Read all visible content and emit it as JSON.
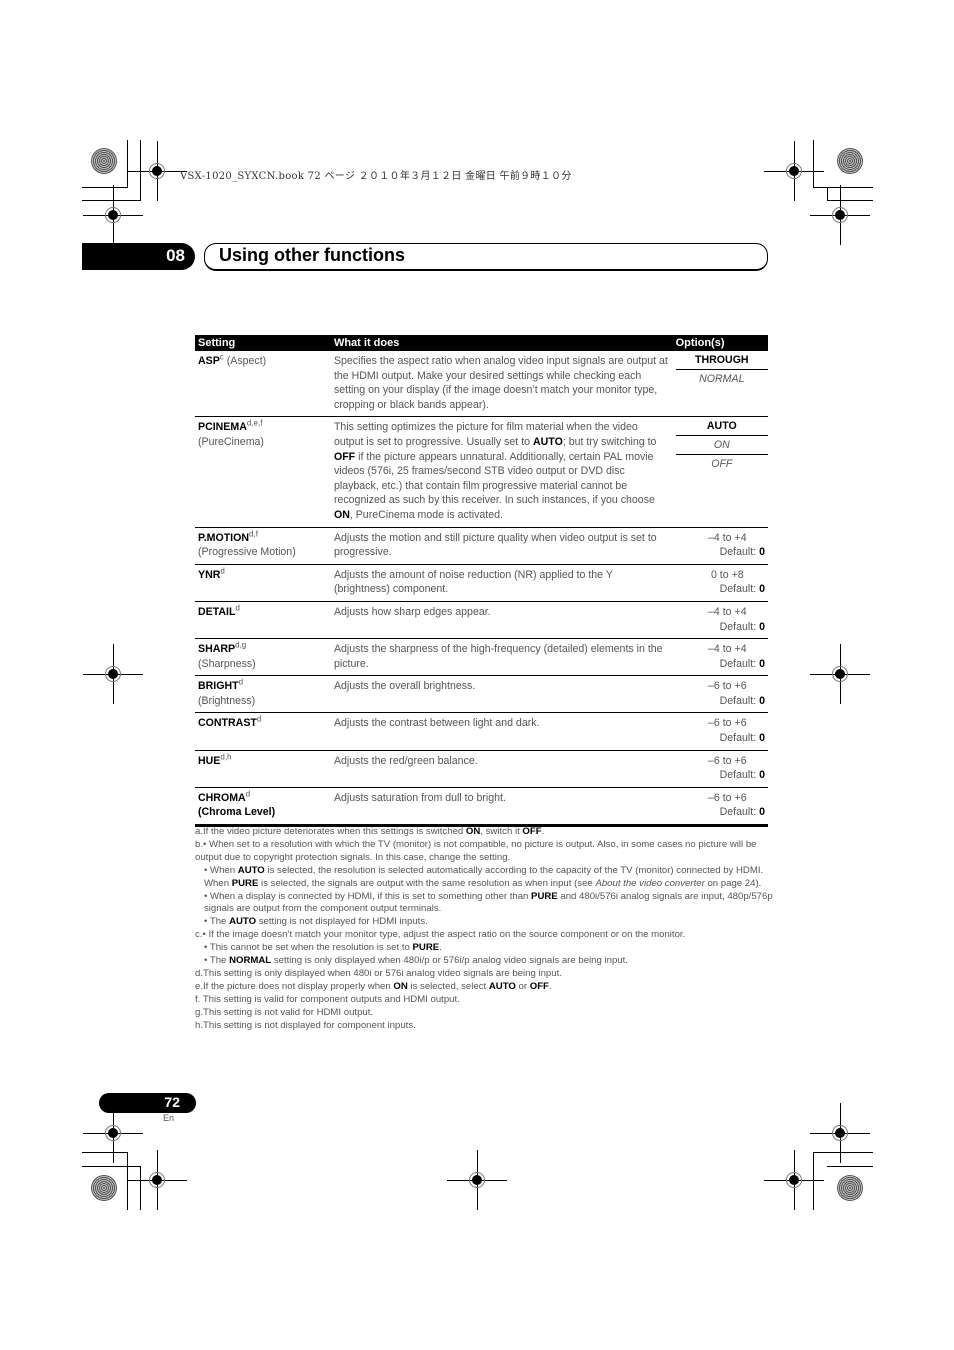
{
  "print_header": "VSX-1020_SYXCN.book  72 ページ  ２０１０年３月１２日  金曜日  午前９時１０分",
  "chapter": {
    "number": "08",
    "title": "Using other functions"
  },
  "table": {
    "headers": [
      "Setting",
      "What it does",
      "Option(s)"
    ],
    "rows": [
      {
        "name": "ASP",
        "sup": "c",
        "subtitle": " (Aspect)",
        "inline_sub": true,
        "description": "Specifies the aspect ratio when analog video input signals are output at the HDMI output. Make your desired settings while checking each setting on your display (if the image doesn’t match your monitor type, cropping or black bands appear).",
        "options": [
          "THROUGH",
          "NORMAL"
        ]
      },
      {
        "name": "PCINEMA",
        "sup": "d,e,f",
        "subtitle": "(PureCinema)",
        "desc_parts": [
          "This setting optimizes the picture for film material when the video output is set to progressive. Usually set to ",
          "AUTO",
          "; but try switching to ",
          "OFF",
          " if the picture appears unnatural. Additionally, certain PAL movie videos (576i, 25 frames/second STB video output or DVD disc playback, etc.) that contain film progressive material cannot be recognized as such by this receiver. In such instances, if you choose ",
          "ON",
          ", PureCinema mode is activated."
        ],
        "options": [
          "AUTO",
          "ON",
          "OFF"
        ]
      },
      {
        "name": "P.MOTION",
        "sup": "d,f",
        "subtitle": "(Progressive Motion)",
        "description": "Adjusts the motion and still picture quality when video output is set to progressive.",
        "range": "–4 to +4",
        "default_label": "Default: ",
        "default": "0"
      },
      {
        "name": "YNR",
        "sup": "d",
        "subtitle": "",
        "description": "Adjusts the amount of noise reduction (NR) applied to the Y (brightness) component.",
        "range": "0 to +8",
        "default_label": "Default: ",
        "default": "0"
      },
      {
        "name": "DETAIL",
        "sup": "d",
        "subtitle": "",
        "description": "Adjusts how sharp edges appear.",
        "range": "–4 to +4",
        "default_label": "Default: ",
        "default": "0"
      },
      {
        "name": "SHARP",
        "sup": "d,g",
        "subtitle": "(Sharpness)",
        "description": "Adjusts the sharpness of the high-frequency (detailed) elements in the picture.",
        "range": "–4 to +4",
        "default_label": "Default: ",
        "default": "0"
      },
      {
        "name": "BRIGHT",
        "sup": "d",
        "subtitle": "(Brightness)",
        "description": "Adjusts the overall brightness.",
        "range": "–6 to +6",
        "default_label": "Default: ",
        "default": "0"
      },
      {
        "name": "CONTRAST",
        "sup": "d",
        "subtitle": "",
        "description": "Adjusts the contrast between light and dark.",
        "range": "–6 to +6",
        "default_label": "Default: ",
        "default": "0"
      },
      {
        "name": "HUE",
        "sup": "d,h",
        "subtitle": "",
        "description": "Adjusts the red/green balance.",
        "range": "–6 to +6",
        "default_label": "Default: ",
        "default": "0"
      },
      {
        "name": "CHROMA",
        "sup": "d",
        "subtitle": "(Chroma Level)",
        "subtitle_bold": true,
        "description": "Adjusts saturation from dull to bright.",
        "range": "–6 to +6",
        "default_label": "Default: ",
        "default": "0"
      }
    ]
  },
  "footnotes": [
    {
      "indent": false,
      "parts": [
        "a.If the video picture deteriorates when this settings is switched ",
        "*ON",
        ", switch it ",
        "*OFF",
        "."
      ]
    },
    {
      "indent": false,
      "parts": [
        "b.• When set to a resolution with which the TV (monitor) is not compatible, no picture is output. Also, in some cases no picture will be output due to copyright protection signals. In this case, change the setting."
      ]
    },
    {
      "indent": true,
      "parts": [
        "• When ",
        "*AUTO",
        " is selected, the resolution is selected automatically according to the capacity of the TV (monitor) connected by HDMI. When ",
        "*PURE",
        " is selected, the signals are output with the same resolution as when input (see ",
        "_About the video converter",
        " on page 24)."
      ]
    },
    {
      "indent": true,
      "parts": [
        "• When a display is connected by HDMI, if this is set to something other than ",
        "*PURE",
        " and 480i/576i analog signals are input, 480p/576p signals are output from the component output terminals."
      ]
    },
    {
      "indent": true,
      "parts": [
        "• The ",
        "*AUTO",
        " setting is not displayed for HDMI inputs."
      ]
    },
    {
      "indent": false,
      "parts": [
        "c.• If the image doesn’t match your monitor type, adjust the aspect ratio on the source component or on the monitor."
      ]
    },
    {
      "indent": true,
      "parts": [
        "• This cannot be set when the resolution is set to ",
        "*PURE",
        "."
      ]
    },
    {
      "indent": true,
      "parts": [
        "• The ",
        "*NORMAL",
        " setting is only displayed when 480i/p or 576i/p analog video signals are being input."
      ]
    },
    {
      "indent": false,
      "parts": [
        "d.This setting is only displayed when 480i or 576i analog video signals are being input."
      ]
    },
    {
      "indent": false,
      "parts": [
        "e.If the picture does not display properly when ",
        "*ON",
        " is selected, select ",
        "*AUTO",
        " or ",
        "*OFF",
        "."
      ]
    },
    {
      "indent": false,
      "parts": [
        "f. This setting is valid for component outputs and HDMI output."
      ]
    },
    {
      "indent": false,
      "parts": [
        "g.This setting is not valid for HDMI output."
      ]
    },
    {
      "indent": false,
      "parts": [
        "h.This setting is not displayed for component inputs."
      ]
    }
  ],
  "page": {
    "number": "72",
    "language": "En"
  }
}
